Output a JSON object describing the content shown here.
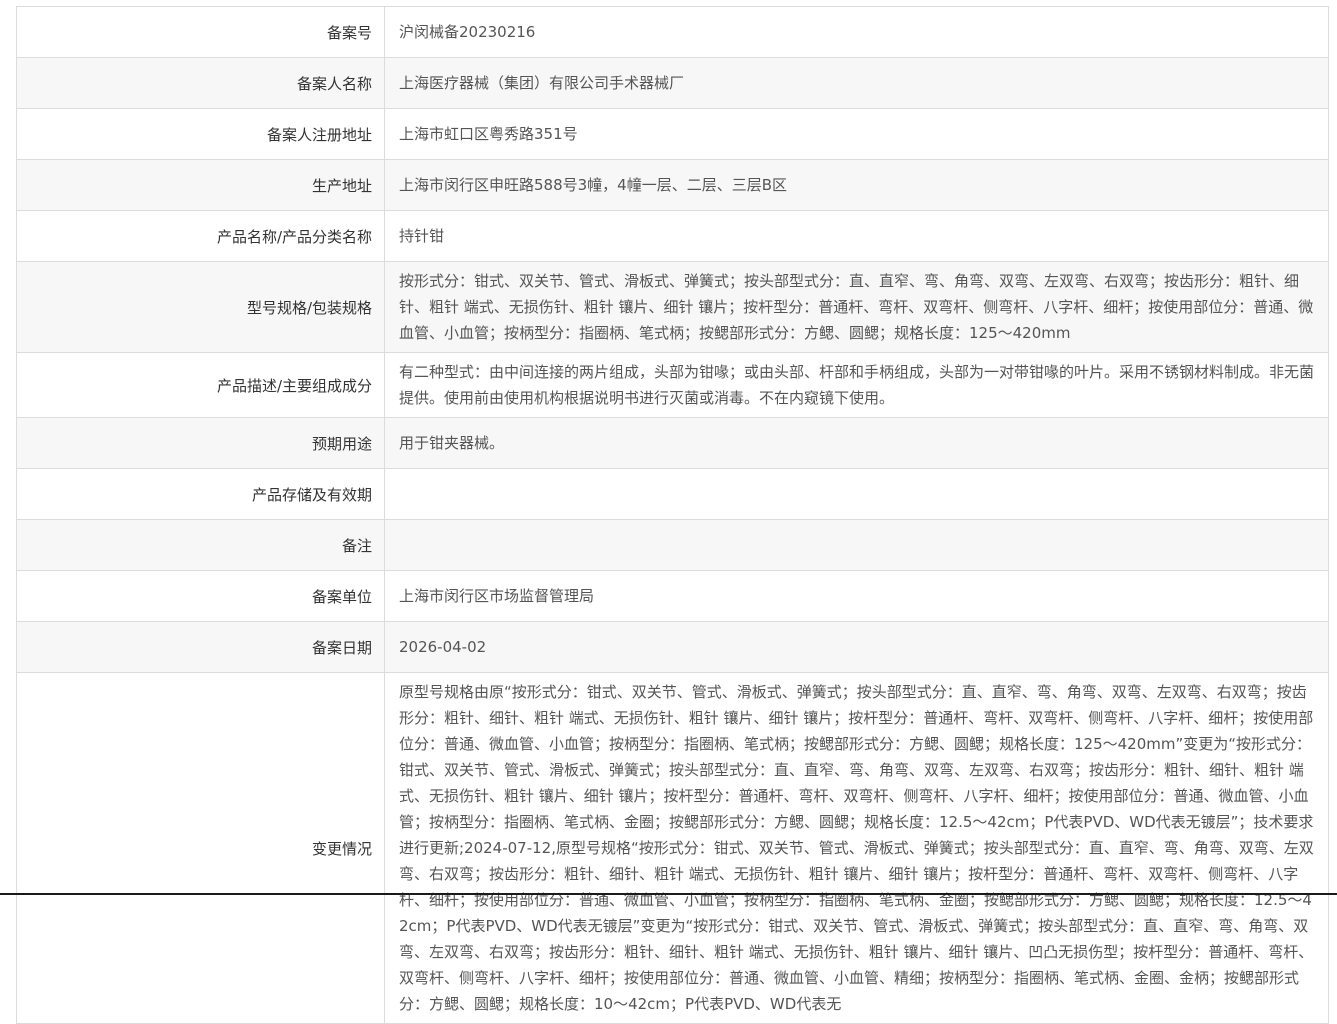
{
  "rows": [
    {
      "label": "备案号",
      "value": "沪闵械备20230216"
    },
    {
      "label": "备案人名称",
      "value": "上海医疗器械（集团）有限公司手术器械厂"
    },
    {
      "label": "备案人注册地址",
      "value": "上海市虹口区粤秀路351号"
    },
    {
      "label": "生产地址",
      "value": "上海市闵行区申旺路588号3幢，4幢一层、二层、三层B区"
    },
    {
      "label": "产品名称/产品分类名称",
      "value": "持针钳"
    },
    {
      "label": "型号规格/包装规格",
      "value": "按形式分：钳式、双关节、管式、滑板式、弹簧式；按头部型式分：直、直窄、弯、角弯、双弯、左双弯、右双弯；按齿形分：粗针、细针、粗针 端式、无损伤针、粗针 镶片、细针 镶片；按杆型分：普通杆、弯杆、双弯杆、侧弯杆、八字杆、细杆；按使用部位分：普通、微血管、小血管；按柄型分：指圈柄、笔式柄；按鳃部形式分：方鳃、圆鳃；规格长度：125～420mm"
    },
    {
      "label": "产品描述/主要组成成分",
      "value": "有二种型式：由中间连接的两片组成，头部为钳喙；或由头部、杆部和手柄组成，头部为一对带钳喙的叶片。采用不锈钢材料制成。非无菌提供。使用前由使用机构根据说明书进行灭菌或消毒。不在内窥镜下使用。"
    },
    {
      "label": "预期用途",
      "value": "用于钳夹器械。"
    },
    {
      "label": "产品存储及有效期",
      "value": ""
    },
    {
      "label": "备注",
      "value": ""
    },
    {
      "label": "备案单位",
      "value": "上海市闵行区市场监督管理局"
    },
    {
      "label": "备案日期",
      "value": "2026-04-02"
    },
    {
      "label": "变更情况",
      "value": "原型号规格由原“按形式分：钳式、双关节、管式、滑板式、弹簧式；按头部型式分：直、直窄、弯、角弯、双弯、左双弯、右双弯；按齿形分：粗针、细针、粗针 端式、无损伤针、粗针 镶片、细针 镶片；按杆型分：普通杆、弯杆、双弯杆、侧弯杆、八字杆、细杆；按使用部位分：普通、微血管、小血管；按柄型分：指圈柄、笔式柄；按鳃部形式分：方鳃、圆鳃；规格长度：125～420mm”变更为“按形式分：钳式、双关节、管式、滑板式、弹簧式；按头部型式分：直、直窄、弯、角弯、双弯、左双弯、右双弯；按齿形分：粗针、细针、粗针 端式、无损伤针、粗针 镶片、细针 镶片；按杆型分：普通杆、弯杆、双弯杆、侧弯杆、八字杆、细杆；按使用部位分：普通、微血管、小血管；按柄型分：指圈柄、笔式柄、金圈；按鳃部形式分：方鳃、圆鳃；规格长度：12.5～42cm；P代表PVD、WD代表无镀层”；技术要求进行更新;2024-07-12,原型号规格“按形式分：钳式、双关节、管式、滑板式、弹簧式；按头部型式分：直、直窄、弯、角弯、双弯、左双弯、右双弯；按齿形分：粗针、细针、粗针 端式、无损伤针、粗针 镶片、细针 镶片；按杆型分：普通杆、弯杆、双弯杆、侧弯杆、八字杆、细杆；按使用部位分：普通、微血管、小血管；按柄型分：指圈柄、笔式柄、金圈；按鳃部形式分：方鳃、圆鳃；规格长度：12.5～42cm；P代表PVD、WD代表无镀层”变更为“按形式分：钳式、双关节、管式、滑板式、弹簧式；按头部型式分：直、直窄、弯、角弯、双弯、左双弯、右双弯；按齿形分：粗针、细针、粗针 端式、无损伤针、粗针 镶片、细针 镶片、凹凸无损伤型；按杆型分：普通杆、弯杆、双弯杆、侧弯杆、八字杆、细杆；按使用部位分：普通、微血管、小血管、精细；按柄型分：指圈柄、笔式柄、金圈、金柄；按鳃部形式分：方鳃、圆鳃；规格长度：10～42cm；P代表PVD、WD代表无"
    }
  ]
}
